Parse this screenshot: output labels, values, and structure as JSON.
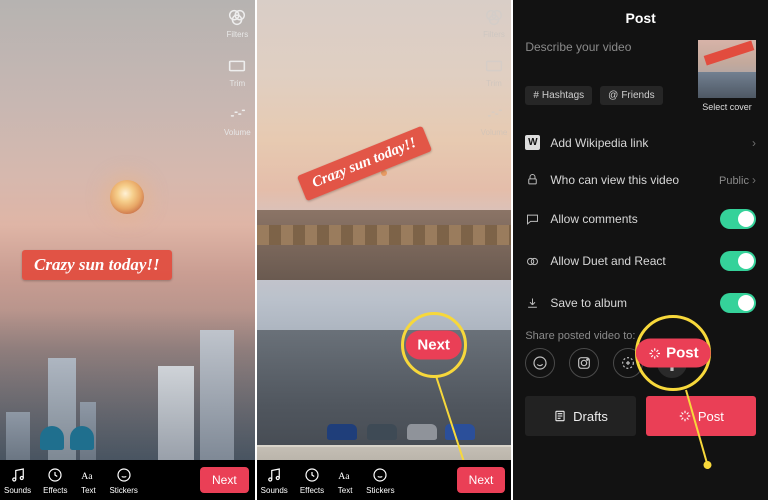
{
  "overlay_text": "Crazy sun today!!",
  "colors": {
    "accent": "#ea3f56",
    "highlight": "#f7d83b",
    "toggle_on": "#35d29a"
  },
  "editor": {
    "side_tools": [
      {
        "id": "filters",
        "label": "Filters"
      },
      {
        "id": "trim",
        "label": "Trim"
      },
      {
        "id": "volume",
        "label": "Volume"
      }
    ],
    "bottom_tools": [
      {
        "id": "sounds",
        "label": "Sounds"
      },
      {
        "id": "effects",
        "label": "Effects"
      },
      {
        "id": "text",
        "label": "Text"
      },
      {
        "id": "stickers",
        "label": "Stickers"
      }
    ],
    "next_label": "Next"
  },
  "callouts": {
    "next": "Next",
    "post": "Post"
  },
  "post": {
    "title": "Post",
    "describe_placeholder": "Describe your video",
    "select_cover": "Select cover",
    "hashtags_label": "Hashtags",
    "friends_label": "Friends",
    "rows": {
      "wikipedia": "Add Wikipedia link",
      "visibility_label": "Who can view this video",
      "visibility_value": "Public",
      "comments": "Allow comments",
      "duet": "Allow Duet and React",
      "save": "Save to album"
    },
    "share_label": "Share posted video to:",
    "drafts_label": "Drafts",
    "post_label": "Post"
  }
}
